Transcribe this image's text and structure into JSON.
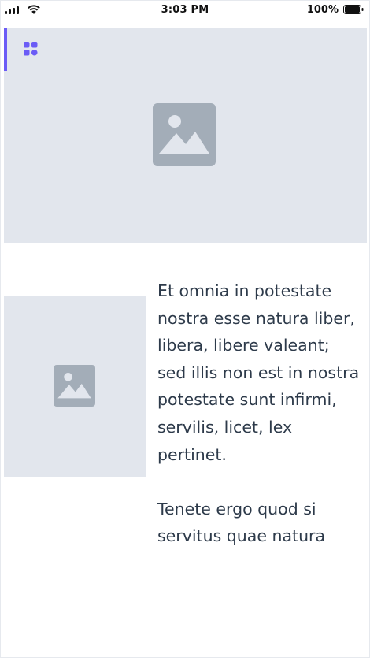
{
  "status_bar": {
    "time": "3:03 PM",
    "battery_percent": "100%",
    "icons": [
      "signal-icon",
      "wifi-icon",
      "battery-icon"
    ]
  },
  "hero": {
    "icons": [
      "grid-icon",
      "image-placeholder-icon"
    ],
    "accent_color": "#6b5cf6",
    "placeholder_color": "#e2e6ed"
  },
  "content": {
    "thumbnail_icon": "image-placeholder-icon",
    "paragraph_1": "Et omnia in potestate nostra esse natura liber, libera, libere valeant; sed illis non est in nostra potestate sunt infirmi, servilis, licet, lex pertinet.",
    "paragraph_2": "Tenete ergo quod si servitus quae natura"
  }
}
